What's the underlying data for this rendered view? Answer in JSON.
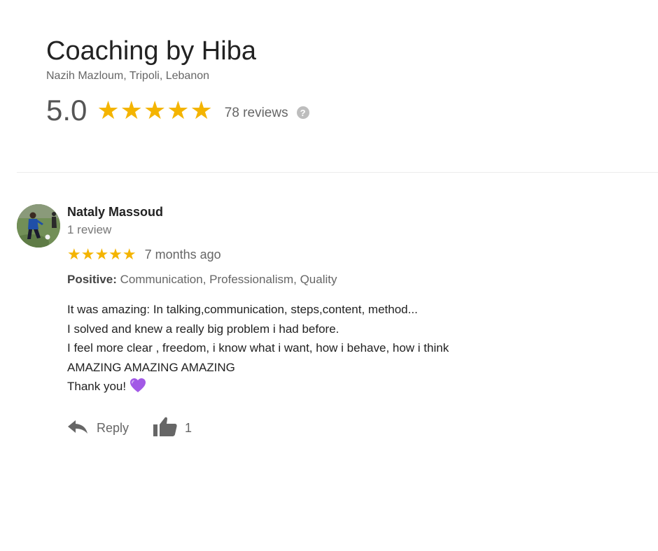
{
  "business": {
    "title": "Coaching by Hiba",
    "address": "Nazih Mazloum, Tripoli, Lebanon",
    "rating": "5.0",
    "stars": "★★★★★",
    "rating_value": 5,
    "review_count_label": "78 reviews",
    "help_icon": "?"
  },
  "review": {
    "reviewer_name": "Nataly Massoud",
    "reviewer_meta": "1 review",
    "stars": "★★★★★",
    "rating_value": 5,
    "date": "7 months ago",
    "positive_label": "Positive:",
    "positive_values": "Communication, Professionalism, Quality",
    "text_lines": [
      "It was amazing:  In talking,communication, steps,content, method...",
      "I solved and knew  a really big problem i had before.",
      "I feel more clear , freedom, i know what i want, how i behave, how i think",
      "AMAZING AMAZING AMAZING",
      "Thank you!"
    ],
    "reply_label": "Reply",
    "like_count": "1"
  },
  "colors": {
    "star": "#f4b400",
    "heart": "#a259e6",
    "text_primary": "#222222",
    "text_secondary": "#666666"
  },
  "icons": {
    "help": "help-circle-icon",
    "reply": "reply-arrow-icon",
    "like": "thumbs-up-icon",
    "heart": "purple-heart-icon"
  }
}
